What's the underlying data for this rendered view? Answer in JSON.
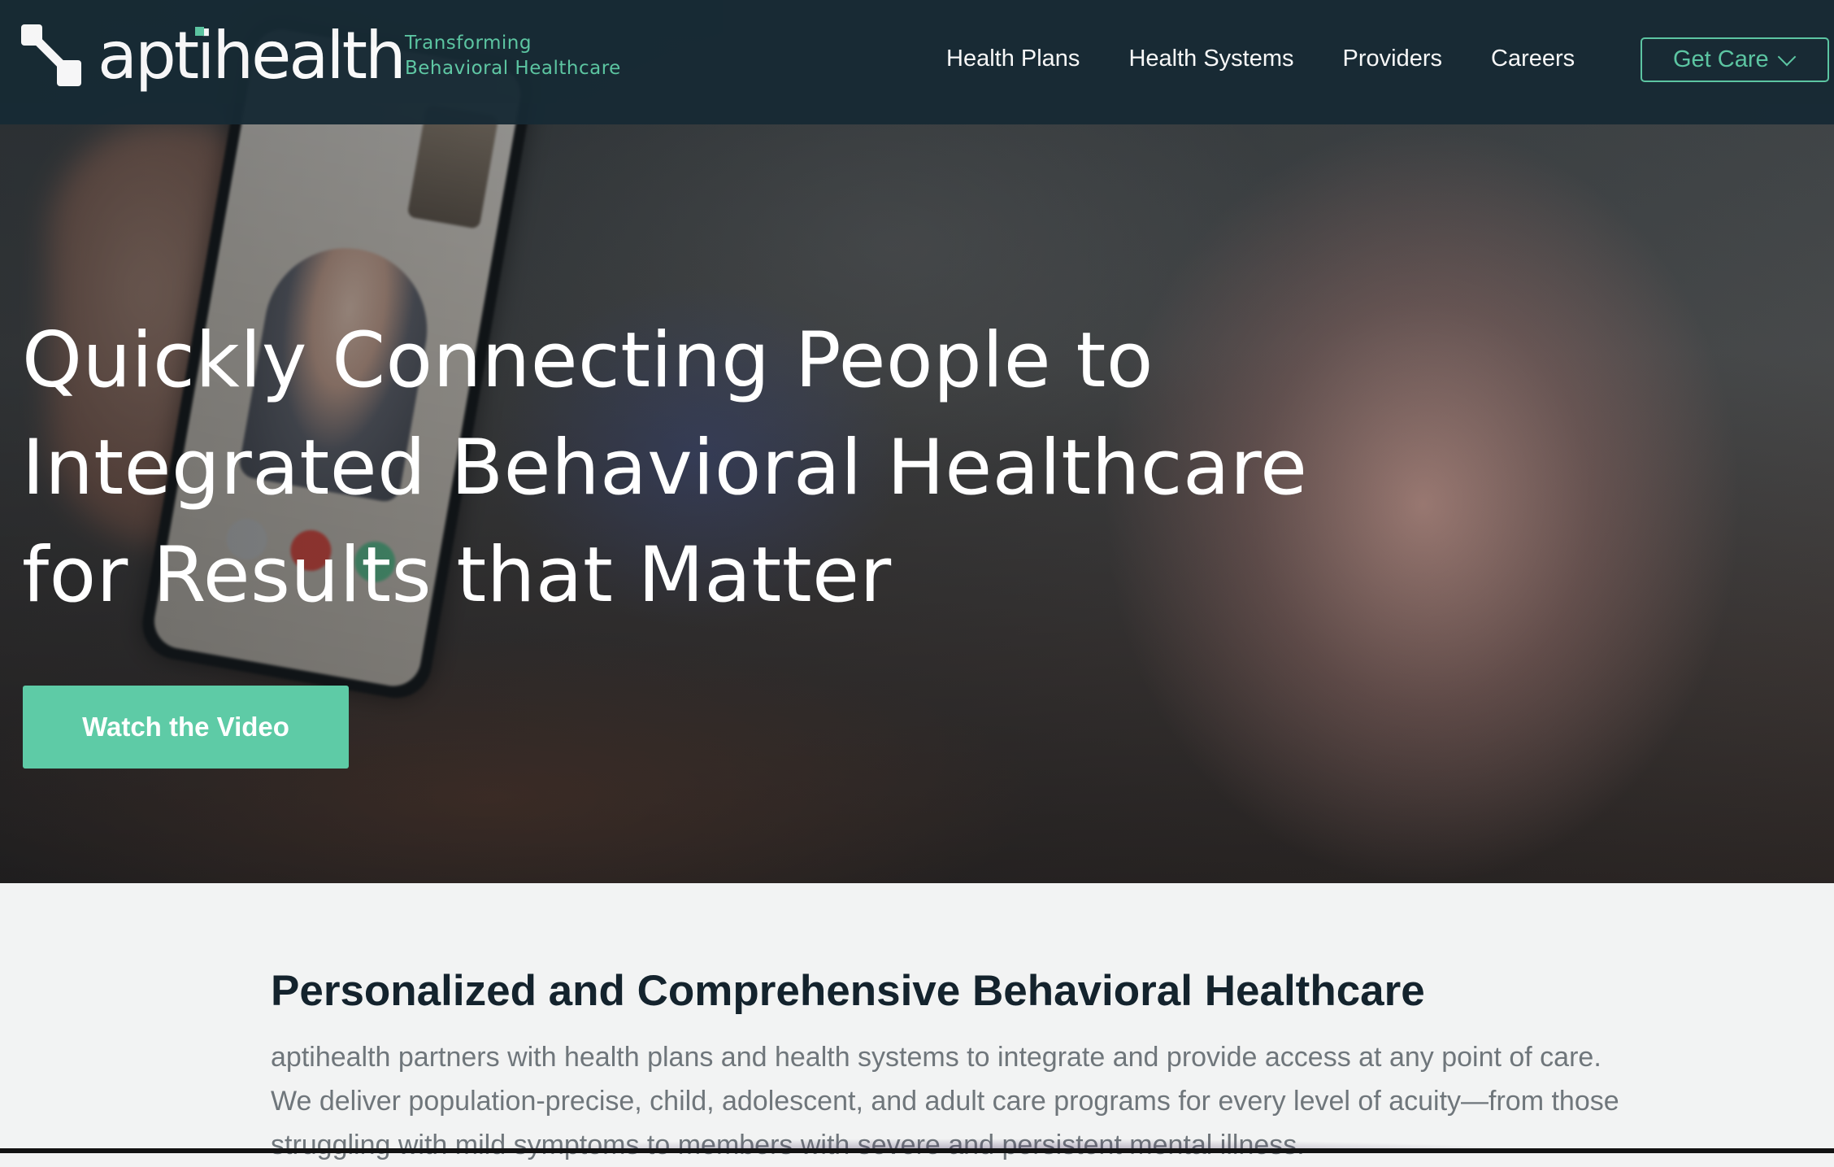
{
  "header": {
    "brand_name": "aptihealth",
    "tagline_line1": "Transforming",
    "tagline_line2": "Behavioral Healthcare",
    "nav": [
      {
        "label": "Health Plans"
      },
      {
        "label": "Health Systems"
      },
      {
        "label": "Providers"
      },
      {
        "label": "Careers"
      }
    ],
    "get_care_label": "Get Care"
  },
  "hero": {
    "title_line1": "Quickly Connecting People to",
    "title_line2": "Integrated Behavioral Healthcare",
    "title_line3": "for Results that Matter",
    "cta_label": "Watch the Video"
  },
  "intro": {
    "heading": "Personalized and Comprehensive Behavioral Healthcare",
    "body_line1": "aptihealth partners with health plans and health systems to integrate and provide access at any point of care.",
    "body_line2": "We deliver population-precise, child, adolescent, and adult care programs for every level of acuity—from those",
    "body_line3": "struggling with mild symptoms to members with severe and persistent mental illness."
  },
  "colors": {
    "brand_green": "#5ecba6",
    "navbar_bg": "#172a34",
    "heading_dark": "#14232d",
    "body_gray": "#6f767b"
  },
  "icons": {
    "logo": "aptihealth-logo-icon",
    "dropdown": "chevron-down-icon"
  }
}
